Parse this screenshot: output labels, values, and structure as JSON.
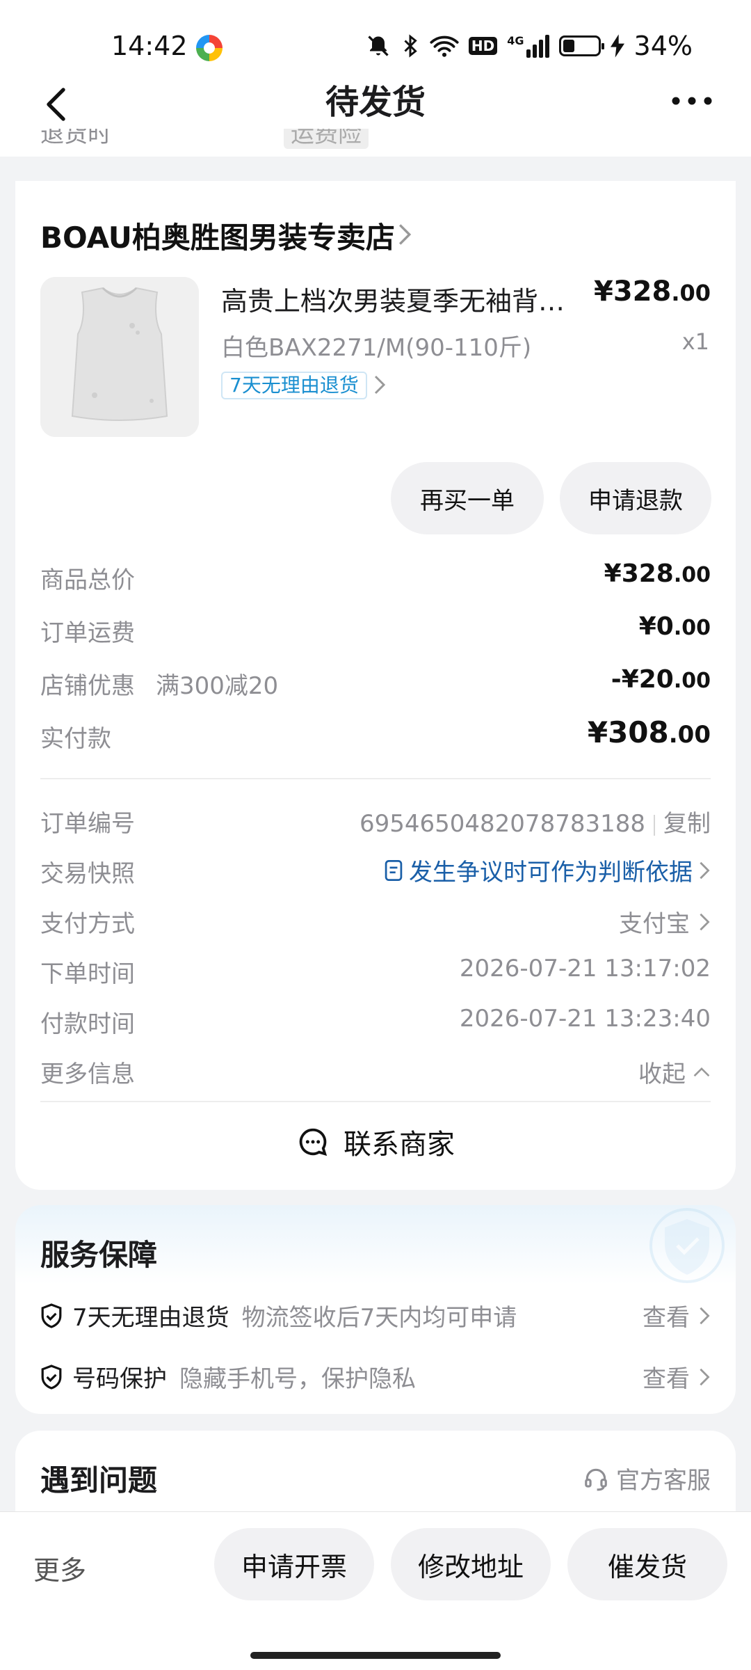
{
  "status_bar": {
    "time": "14:42",
    "icons": [
      "app-icon",
      "mute-icon",
      "bluetooth-icon",
      "wifi-icon",
      "hd-icon",
      "signal-icon",
      "battery-icon",
      "charging-icon"
    ],
    "hd_label": "HD",
    "network_label": "4G",
    "battery_percent": "34%",
    "battery_level": 0.34
  },
  "nav": {
    "title": "待发货",
    "back_icon": "back-arrow-icon",
    "more_icon": "more-dots-icon"
  },
  "order": {
    "shop_name": "BOAU柏奥胜图男装专卖店",
    "product": {
      "title": "高贵上档次男装夏季无袖背…",
      "sku": "白色BAX2271/M(90-110斤)",
      "price_int": "¥328",
      "price_dec": ".00",
      "quantity": "x1",
      "return_tag": "7天无理由退货"
    },
    "actions": {
      "buy_again": "再买一单",
      "refund": "申请退款"
    },
    "price_rows": [
      {
        "label": "商品总价",
        "int": "¥328",
        "dec": ".00"
      },
      {
        "label": "订单运费",
        "int": "¥0",
        "dec": ".00"
      },
      {
        "label": "店铺优惠",
        "note": "满300减20",
        "int": "-¥20",
        "dec": ".00"
      },
      {
        "label": "实付款",
        "int": "¥308",
        "dec": ".00"
      }
    ],
    "info_rows": {
      "order_no_label": "订单编号",
      "order_no": "6954650482078783188",
      "copy_label": "复制",
      "snapshot_label": "交易快照",
      "snapshot_value": "发生争议时可作为判断依据",
      "payment_label": "支付方式",
      "payment_value": "支付宝",
      "order_time_label": "下单时间",
      "order_time": "2026-07-21 13:17:02",
      "pay_time_label": "付款时间",
      "pay_time": "2026-07-21 13:23:40",
      "more_info_label": "更多信息",
      "collapse_label": "收起"
    },
    "contact_label": "联系商家"
  },
  "service": {
    "title": "服务保障",
    "items": [
      {
        "name": "7天无理由退货",
        "desc": "物流签收后7天内均可申请",
        "action": "查看"
      },
      {
        "name": "号码保护",
        "desc": "隐藏手机号，保护隐私",
        "action": "查看"
      }
    ]
  },
  "problems": {
    "title": "遇到问题",
    "customer_service": "官方客服"
  },
  "bottom_bar": {
    "more": "更多",
    "invoice": "申请开票",
    "change_address": "修改地址",
    "urge_shipping": "催发货"
  },
  "colors": {
    "background": "#f2f3f5",
    "card": "#ffffff",
    "link_blue": "#1a5fa8",
    "tag_blue": "#1a8fd0",
    "muted": "#8e8e93"
  }
}
